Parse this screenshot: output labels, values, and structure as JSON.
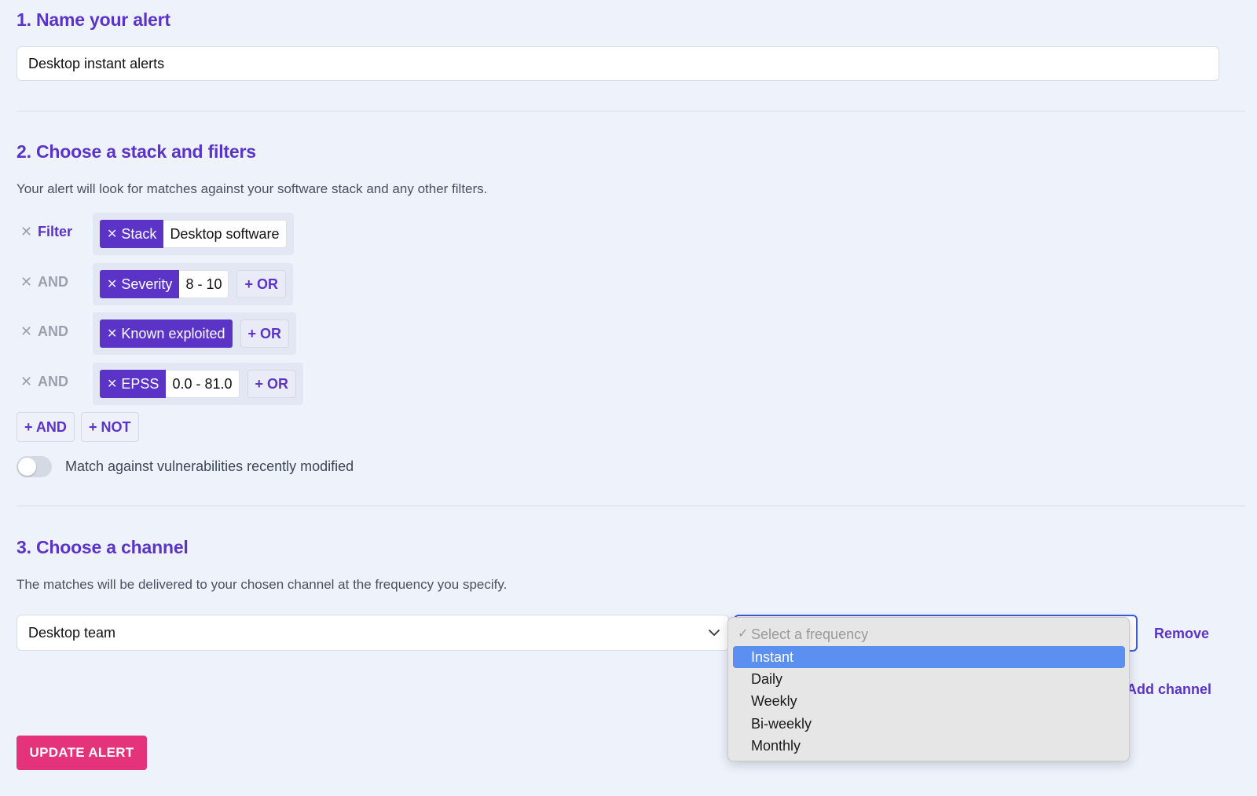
{
  "section1": {
    "title": "1. Name your alert",
    "alert_name": "Desktop instant alerts"
  },
  "section2": {
    "title": "2. Choose a stack and filters",
    "help": "Your alert will look for matches against your software stack and any other filters.",
    "remove_glyph": "✕",
    "chip_remove_glyph": "✕",
    "rows": [
      {
        "label": "Filter",
        "chip": "Stack",
        "value": "Desktop software",
        "or": ""
      },
      {
        "label": "AND",
        "chip": "Severity",
        "value": "8 - 10",
        "or": "+ OR"
      },
      {
        "label": "AND",
        "chip": "Known exploited",
        "value": "",
        "or": "+ OR"
      },
      {
        "label": "AND",
        "chip": "EPSS",
        "value": "0.0 - 81.0",
        "or": "+ OR"
      }
    ],
    "add_and": "+ AND",
    "add_not": "+ NOT",
    "toggle_label": "Match against vulnerabilities recently modified",
    "toggle_on": false
  },
  "section3": {
    "title": "3. Choose a channel",
    "help": "The matches will be delivered to your chosen channel at the frequency you specify.",
    "channel": "Desktop team",
    "remove": "Remove",
    "add_channel": "Add channel",
    "frequency_menu": {
      "check": "✓",
      "placeholder": "Select a frequency",
      "options": [
        "Instant",
        "Daily",
        "Weekly",
        "Bi-weekly",
        "Monthly"
      ],
      "highlighted": "Instant"
    }
  },
  "update_button": "UPDATE ALERT",
  "colors": {
    "accent": "#5b34c7",
    "primary_button": "#e4337a",
    "highlight": "#5b8ff0",
    "background": "#eef2fb"
  }
}
